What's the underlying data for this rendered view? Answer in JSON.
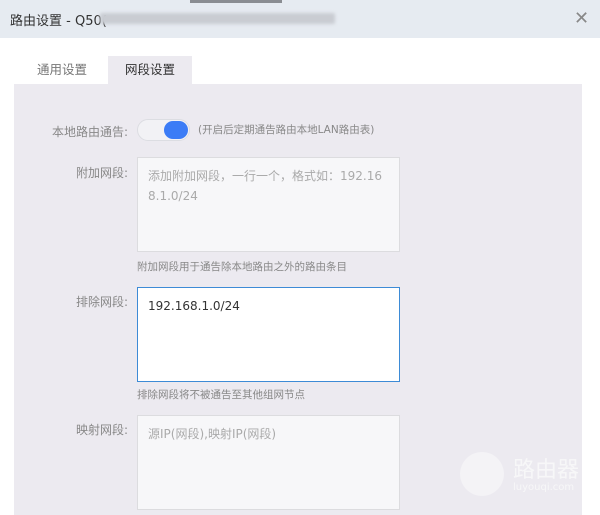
{
  "window": {
    "title": "路由设置 - Q50(",
    "close_icon": "close-icon"
  },
  "tabs": [
    {
      "label": "通用设置",
      "active": false
    },
    {
      "label": "网段设置",
      "active": true
    }
  ],
  "toggle": {
    "label": "本地路由通告:",
    "on": true,
    "description": "(开启后定期通告路由本地LAN路由表)",
    "color": "#3b7cf6"
  },
  "additional": {
    "label": "附加网段:",
    "placeholder": "添加附加网段，一行一个，格式如：192.168.1.0/24",
    "value": "",
    "hint": "附加网段用于通告除本地路由之外的路由条目"
  },
  "exclude": {
    "label": "排除网段:",
    "value": "192.168.1.0/24",
    "hint": "排除网段将不被通告至其他组网节点"
  },
  "mapping": {
    "label": "映射网段:",
    "placeholder": "源IP(网段),映射IP(网段)",
    "value": ""
  },
  "watermark": {
    "text": "路由器",
    "url": "luyouqi.com"
  }
}
